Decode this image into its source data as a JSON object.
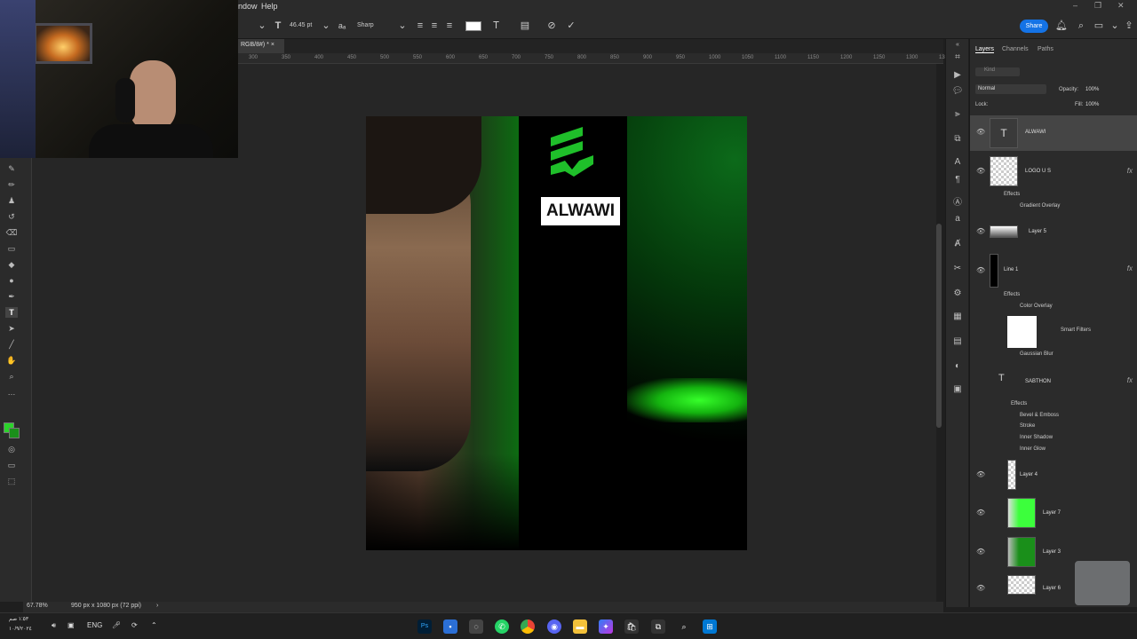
{
  "menu": {
    "window_partial": "ndow",
    "help": "Help"
  },
  "options": {
    "font_size": "46.45 pt",
    "antialias": "Sharp",
    "share": "Share"
  },
  "doc_tab": {
    "title_partial": "RGB/8#) *"
  },
  "ruler_marks": [
    "300",
    "350",
    "400",
    "450",
    "500",
    "550",
    "600",
    "650",
    "700",
    "750",
    "800",
    "850",
    "900",
    "950",
    "1000",
    "1050",
    "1100",
    "1150",
    "1200",
    "1250",
    "1300",
    "1350"
  ],
  "canvas": {
    "name_text": "ALWAWI"
  },
  "status": {
    "zoom": "67.78%",
    "doc_info": "950 px x 1080 px (72 ppi)"
  },
  "panel": {
    "tabs": [
      "Layers",
      "Channels",
      "Paths"
    ],
    "kind_placeholder": "Kind",
    "blend_mode": "Normal",
    "opacity_label": "Opacity:",
    "opacity_value": "100%",
    "lock_label": "Lock:",
    "fill_label": "Fill:",
    "fill_value": "100%",
    "layers": [
      {
        "name": "ALWAWI"
      },
      {
        "name": "LOGO U S"
      },
      {
        "name": "Layer 5"
      },
      {
        "name": "Line 1"
      },
      {
        "name": "SABTHON"
      },
      {
        "name": "Layer 4"
      },
      {
        "name": "Layer 7"
      },
      {
        "name": "Layer 3"
      },
      {
        "name": "Layer 6"
      }
    ],
    "logo_effects": {
      "effects": "Effects",
      "gradient": "Gradient Overlay"
    },
    "line_effects": {
      "effects": "Effects",
      "color_overlay": "Color Overlay",
      "smart_filters": "Smart Filters",
      "gaussian": "Gaussian Blur"
    },
    "sabthon_effects": {
      "effects": "Effects",
      "bevel": "Bevel & Emboss",
      "stroke": "Stroke",
      "inner_shadow": "Inner Shadow",
      "inner_glow": "Inner Glow"
    }
  },
  "taskbar": {
    "lang": "ENG",
    "clock_partial": "١:٥٣ صم",
    "date_partial": "١٠/٩/٢٠٢٤"
  },
  "colors": {
    "accent": "#1473e6",
    "green": "#2bd32b",
    "ui_bg": "#2b2b2b"
  }
}
